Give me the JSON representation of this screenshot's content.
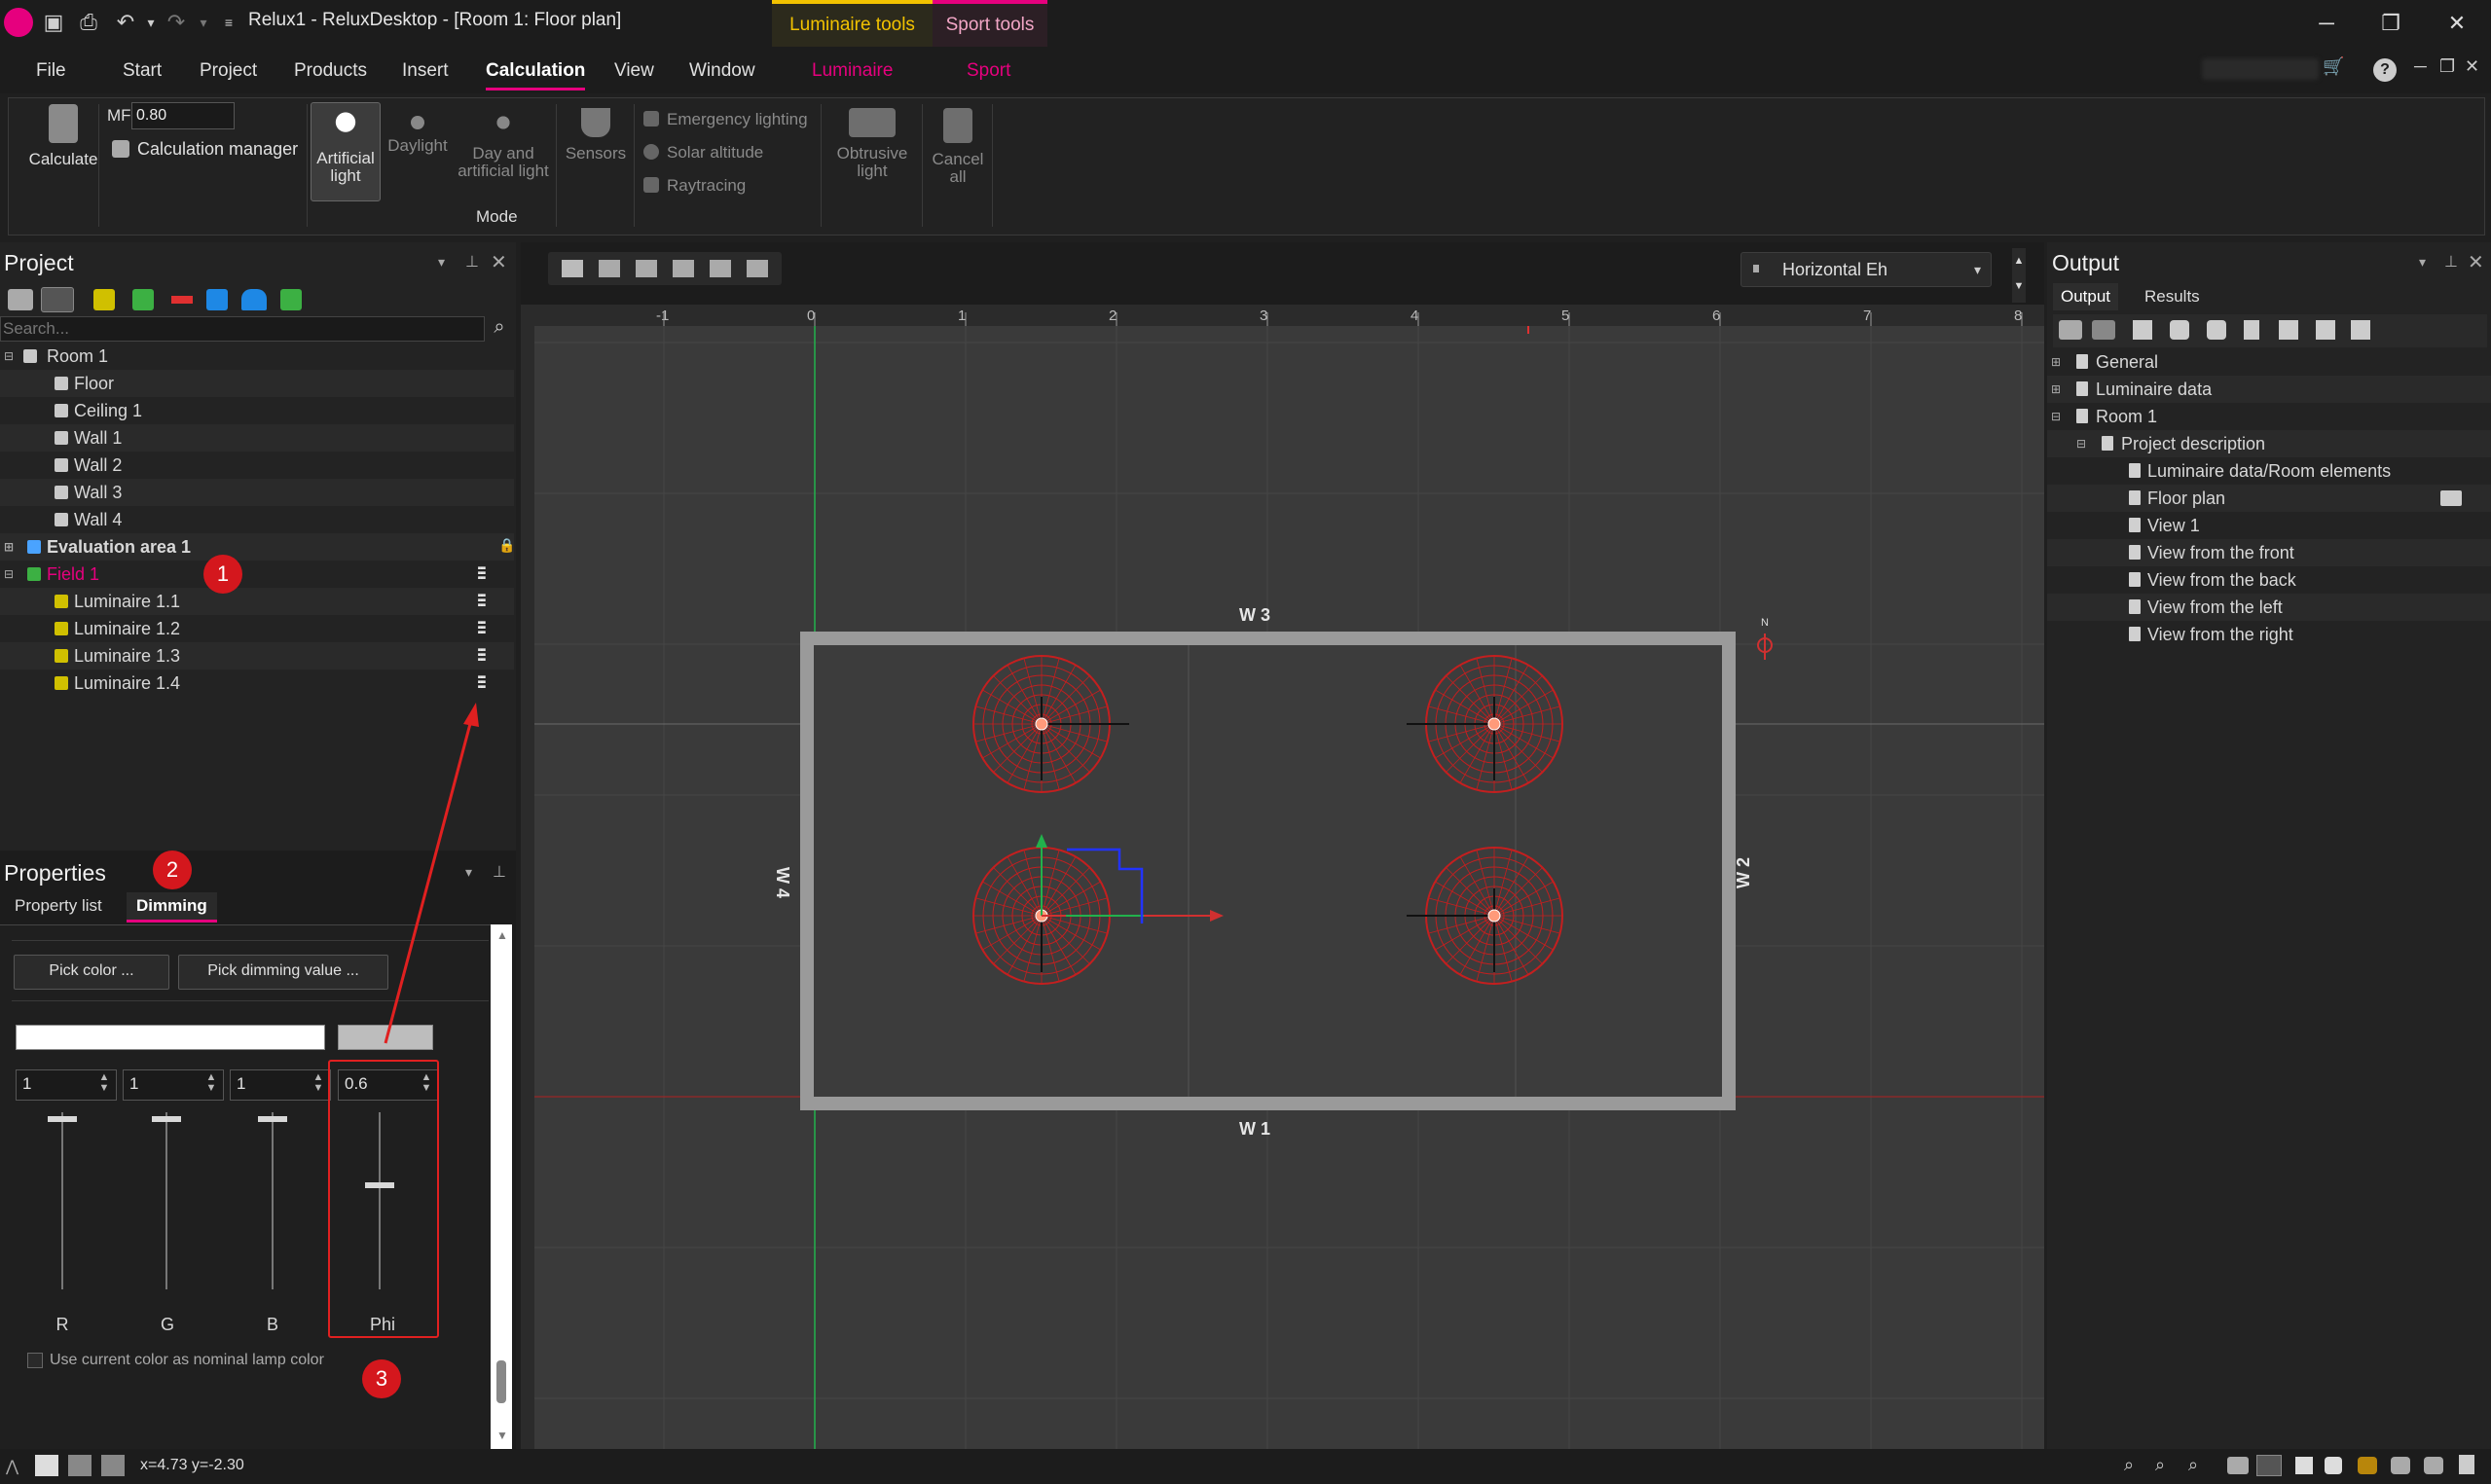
{
  "titlebar": {
    "title": "Relux1 - ReluxDesktop - [Room 1: Floor plan]",
    "ctx_luminaire": "Luminaire tools",
    "ctx_sport": "Sport tools",
    "min": "─",
    "restore": "❐",
    "close": "✕"
  },
  "menu": [
    "File",
    "Start",
    "Project",
    "Products",
    "Insert",
    "Calculation",
    "View",
    "Window",
    "Luminaire",
    "Sport"
  ],
  "ribbon": {
    "calculate": "Calculate",
    "mf_label": "MF",
    "mf_value": "0.80",
    "calc_manager": "Calculation manager",
    "artificial": "Artificial light",
    "daylight": "Daylight",
    "day_artificial": "Day and artificial light",
    "sensors": "Sensors",
    "emergency": "Emergency lighting",
    "solar": "Solar altitude",
    "raytracing": "Raytracing",
    "obtrusive": "Obtrusive light",
    "cancel": "Cancel all",
    "group_mode": "Mode"
  },
  "project": {
    "title": "Project",
    "search_placeholder": "Search...",
    "tree": [
      {
        "label": "Room 1",
        "indent": 1
      },
      {
        "label": "Floor",
        "indent": 2
      },
      {
        "label": "Ceiling 1",
        "indent": 2
      },
      {
        "label": "Wall 1",
        "indent": 2
      },
      {
        "label": "Wall 2",
        "indent": 2
      },
      {
        "label": "Wall 3",
        "indent": 2
      },
      {
        "label": "Wall 4",
        "indent": 2
      },
      {
        "label": "Evaluation area 1",
        "indent": 1
      },
      {
        "label": "Field 1",
        "indent": 1
      },
      {
        "label": "Luminaire  1.1",
        "indent": 2
      },
      {
        "label": "Luminaire  1.2",
        "indent": 2
      },
      {
        "label": "Luminaire  1.3",
        "indent": 2
      },
      {
        "label": "Luminaire  1.4",
        "indent": 2
      }
    ]
  },
  "annotations": {
    "b1": "1",
    "b2": "2",
    "b3": "3"
  },
  "properties": {
    "title": "Properties",
    "tab_list": "Property list",
    "tab_dimming": "Dimming",
    "pick_color": "Pick color ...",
    "pick_dimming": "Pick dimming value ...",
    "r_val": "1",
    "g_val": "1",
    "b_val": "1",
    "phi_val": "0.6",
    "r": "R",
    "g": "G",
    "b": "B",
    "phi": "Phi",
    "checkbox": "Use current color as nominal lamp color"
  },
  "viewport": {
    "view_mode": "Horizontal Eh",
    "ruler": [
      "-1",
      "0",
      "1",
      "2",
      "3",
      "4",
      "5",
      "6",
      "7",
      "8"
    ],
    "w1": "W 1",
    "w2": "W 2",
    "w3": "W 3",
    "w4": "W 4"
  },
  "output": {
    "title": "Output",
    "tab_output": "Output",
    "tab_results": "Results",
    "tree": [
      {
        "label": "General",
        "indent": 1
      },
      {
        "label": "Luminaire data",
        "indent": 1
      },
      {
        "label": "Room 1",
        "indent": 1
      },
      {
        "label": "Project description",
        "indent": 2
      },
      {
        "label": "Luminaire data/Room elements",
        "indent": 3
      },
      {
        "label": "Floor plan",
        "indent": 3
      },
      {
        "label": "View 1",
        "indent": 3
      },
      {
        "label": "View from the front",
        "indent": 3
      },
      {
        "label": "View from the back",
        "indent": 3
      },
      {
        "label": "View from the left",
        "indent": 3
      },
      {
        "label": "View from the right",
        "indent": 3
      }
    ]
  },
  "status": {
    "coords": "x=4.73 y=-2.30"
  },
  "colors": {
    "accent": "#e6007e",
    "luminaire_ctx": "#f2c200",
    "annotation": "#d4171d"
  }
}
